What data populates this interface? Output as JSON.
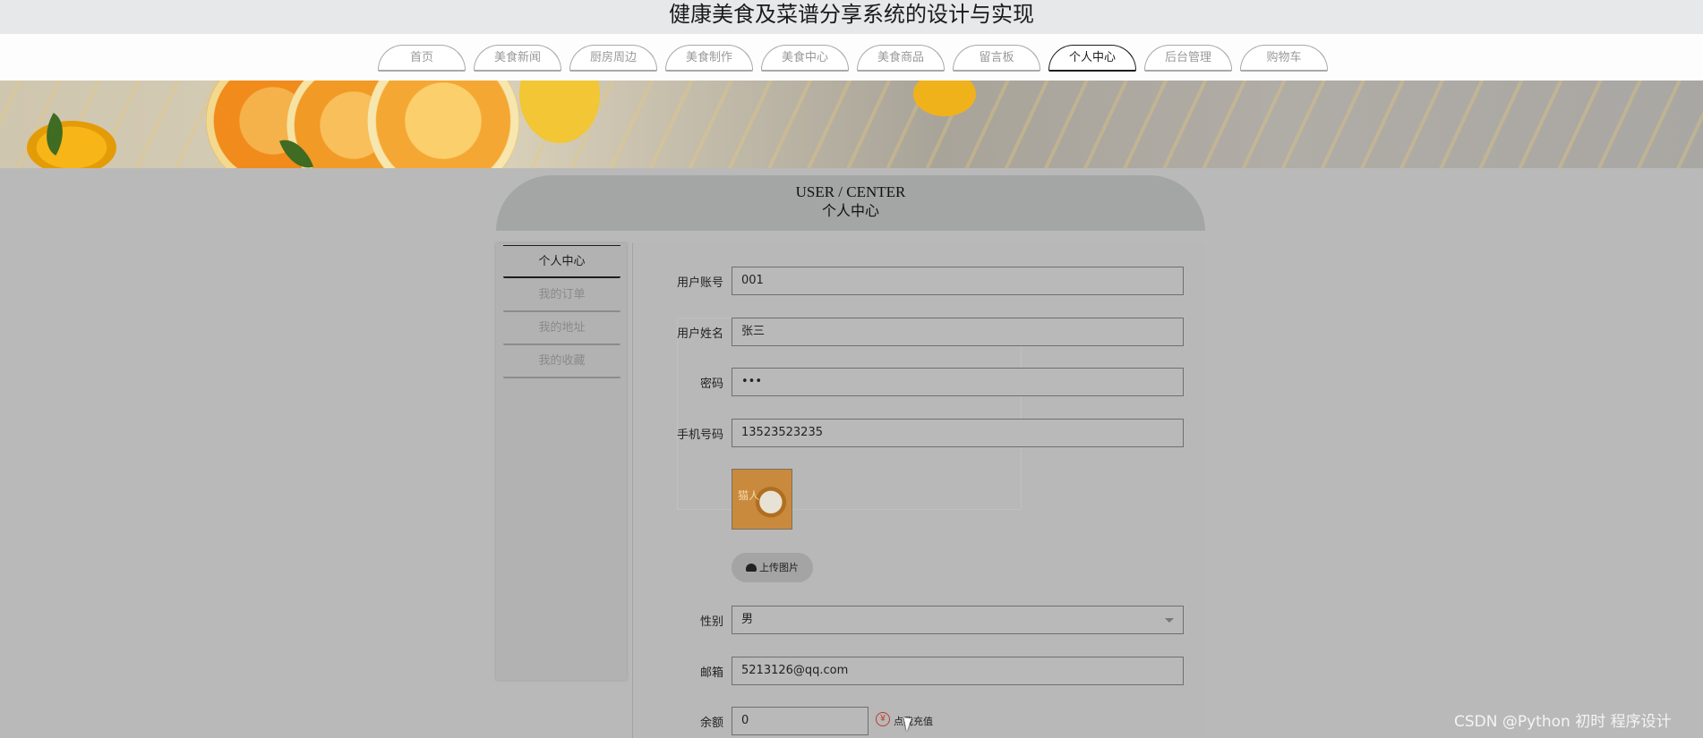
{
  "site_title": "健康美食及菜谱分享系统的设计与实现",
  "nav": [
    "首页",
    "美食新闻",
    "厨房周边",
    "美食制作",
    "美食中心",
    "美食商品",
    "留言板",
    "个人中心",
    "后台管理",
    "购物车"
  ],
  "nav_active": "个人中心",
  "user_center": {
    "en_title": "USER / CENTER",
    "cn_title": "个人中心"
  },
  "side_menu": [
    "个人中心",
    "我的订单",
    "我的地址",
    "我的收藏"
  ],
  "form": {
    "account_label": "用户账号",
    "account_value": "001",
    "name_label": "用户姓名",
    "name_value": "张三",
    "password_label": "密码",
    "password_value": "•••",
    "phone_label": "手机号码",
    "phone_value": "13523523235",
    "avatar_text": "猫人",
    "upload_label": "上传图片",
    "gender_label": "性别",
    "gender_value": "男",
    "email_label": "邮箱",
    "email_value": "5213126@qq.com",
    "balance_label": "余额",
    "balance_value": "0",
    "recharge_icon": "¥",
    "recharge_label": "点我充值"
  },
  "watermark": "CSDN @Python 初时 程序设计",
  "colors": {
    "page_bg": "#b9b9b9",
    "active_nav": "#1d1d1d",
    "recharge_accent": "#c0392b"
  }
}
